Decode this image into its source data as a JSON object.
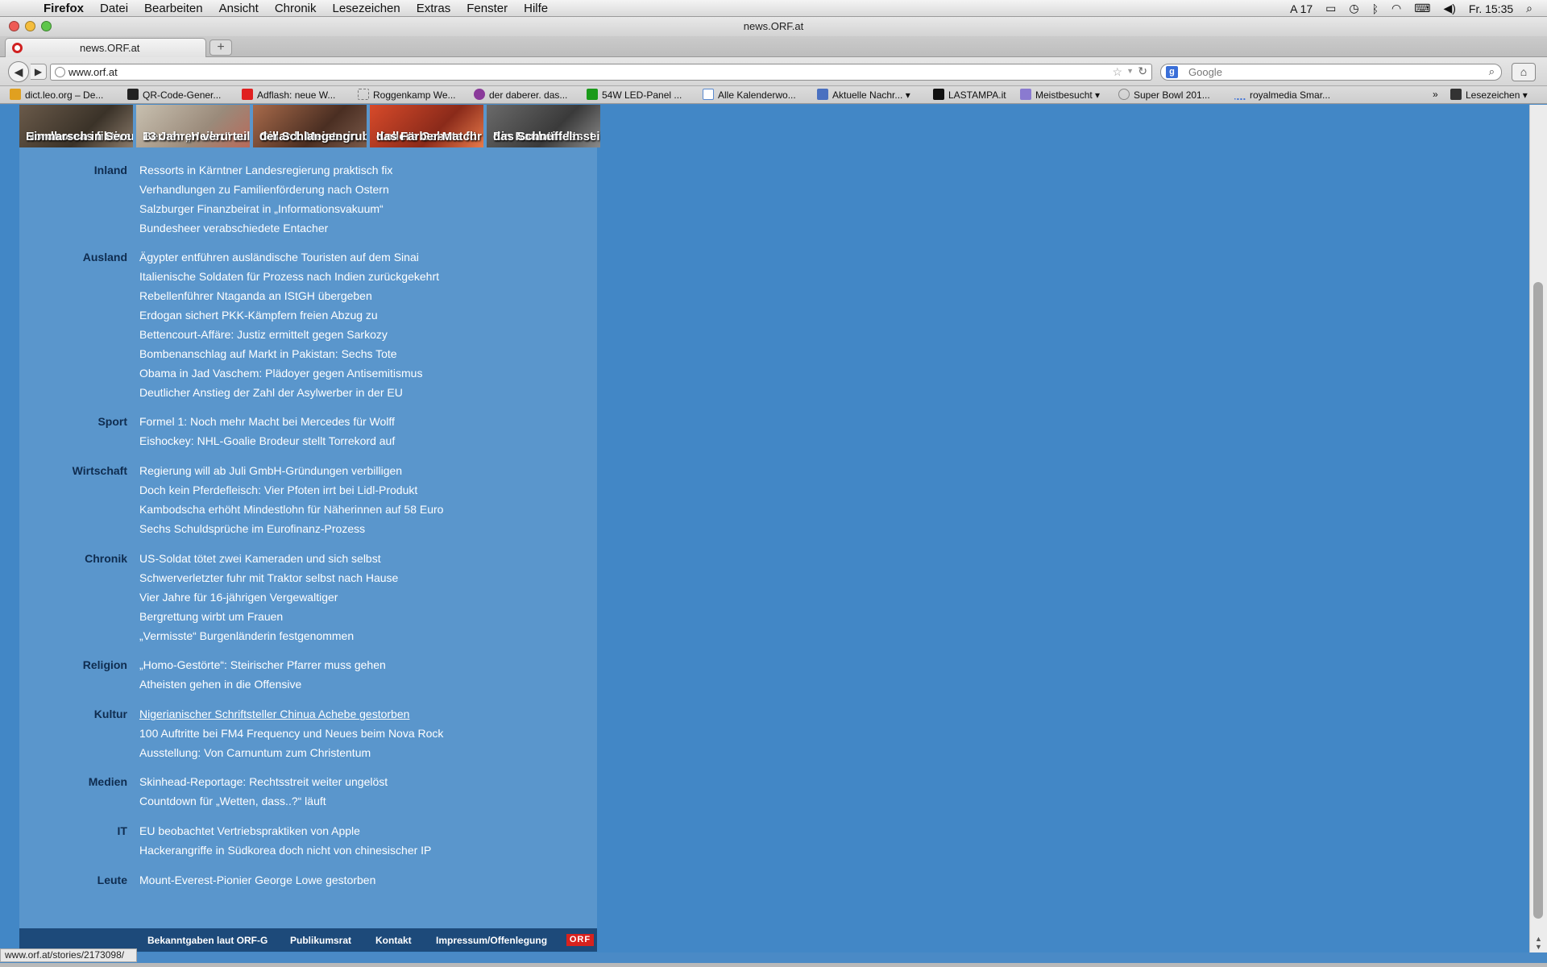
{
  "menubar": {
    "app": "Firefox",
    "items": [
      "Datei",
      "Bearbeiten",
      "Ansicht",
      "Chronik",
      "Lesezeichen",
      "Extras",
      "Fenster",
      "Hilfe"
    ],
    "adobe_count": "17",
    "clock": "Fr. 15:35"
  },
  "window": {
    "title": "news.ORF.at"
  },
  "tab": {
    "title": "news.ORF.at",
    "new_tab": "+"
  },
  "navbar": {
    "url": "www.orf.at",
    "search_placeholder": "Google"
  },
  "bookmarks": {
    "items": [
      "dict.leo.org – De...",
      "QR-Code-Gener...",
      "Adflash: neue W...",
      "Roggenkamp We...",
      "der daberer. das...",
      "54W LED-Panel ...",
      "Alle Kalenderwo...",
      "Aktuelle Nachr...",
      "LASTAMPA.it",
      "Meistbesucht",
      "Super Bowl 201...",
      "royalmedia Smar..."
    ],
    "overflow": "»",
    "lesezeichen": "Lesezeichen"
  },
  "teasers": [
    {
      "line1": "Nordkoreas fiktiver",
      "line2": "Einmarsch in Seoul"
    },
    {
      "line1": "Berner „Heiler“ zu",
      "line2": "13 Jahren verurteilt"
    },
    {
      "line1": "Gillard: Meisterin",
      "line2": "der Schlangengrube"
    },
    {
      "line1": "Kollers Gebote für",
      "line2": "das Färber-Match"
    },
    {
      "line1": "Ein Raubein lässt",
      "line2": "das Schnüffeln sein"
    }
  ],
  "sections": [
    {
      "label": "Inland",
      "items": [
        "Ressorts in Kärntner Landesregierung praktisch fix",
        "Verhandlungen zu Familienförderung nach Ostern",
        "Salzburger Finanzbeirat in „Informationsvakuum“",
        "Bundesheer verabschiedete Entacher"
      ]
    },
    {
      "label": "Ausland",
      "items": [
        "Ägypter entführen ausländische Touristen auf dem Sinai",
        "Italienische Soldaten für Prozess nach Indien zurückgekehrt",
        "Rebellenführer Ntaganda an IStGH übergeben",
        "Erdogan sichert PKK-Kämpfern freien Abzug zu",
        "Bettencourt-Affäre: Justiz ermittelt gegen Sarkozy",
        "Bombenanschlag auf Markt in Pakistan: Sechs Tote",
        "Obama in Jad Vaschem: Plädoyer gegen Antisemitismus",
        "Deutlicher Anstieg der Zahl der Asylwerber in der EU"
      ]
    },
    {
      "label": "Sport",
      "items": [
        "Formel 1: Noch mehr Macht bei Mercedes für Wolff",
        "Eishockey: NHL-Goalie Brodeur stellt Torrekord auf"
      ]
    },
    {
      "label": "Wirtschaft",
      "items": [
        "Regierung will ab Juli GmbH-Gründungen verbilligen",
        "Doch kein Pferdefleisch: Vier Pfoten irrt bei Lidl-Produkt",
        "Kambodscha erhöht Mindestlohn für Näherinnen auf 58 Euro",
        "Sechs Schuldsprüche im Eurofinanz-Prozess"
      ]
    },
    {
      "label": "Chronik",
      "items": [
        "US-Soldat tötet zwei Kameraden und sich selbst",
        "Schwerverletzter fuhr mit Traktor selbst nach Hause",
        "Vier Jahre für 16-jährigen Vergewaltiger",
        "Bergrettung wirbt um Frauen",
        "„Vermisste“ Burgenländerin festgenommen"
      ]
    },
    {
      "label": "Religion",
      "items": [
        "„Homo-Gestörte“: Steirischer Pfarrer muss gehen",
        "Atheisten gehen in die Offensive"
      ]
    },
    {
      "label": "Kultur",
      "items": [
        "Nigerianischer Schriftsteller Chinua Achebe gestorben",
        "100 Auftritte bei FM4 Frequency und Neues beim Nova Rock",
        "Ausstellung: Von Carnuntum zum Christentum"
      ]
    },
    {
      "label": "Medien",
      "items": [
        "Skinhead-Reportage: Rechtsstreit weiter ungelöst",
        "Countdown für „Wetten, dass..?“ läuft"
      ]
    },
    {
      "label": "IT",
      "items": [
        "EU beobachtet Vertriebspraktiken von Apple",
        "Hackerangriffe in Südkorea doch nicht von chinesischer IP"
      ]
    },
    {
      "label": "Leute",
      "items": [
        "Mount-Everest-Pionier George Lowe gestorben"
      ]
    }
  ],
  "footer": {
    "links": [
      "Bekanntgaben laut ORF-G",
      "Publikumsrat",
      "Kontakt",
      "Impressum/Offenlegung"
    ],
    "logo": "ORF"
  },
  "status": {
    "url": "www.orf.at/stories/2173098/"
  },
  "colors": {
    "page_bg": "#4287c6",
    "column_bg": "#5a96cc",
    "footer_bg": "#1d4a7a",
    "section_label": "#0f2c4f",
    "orf_red": "#d8221e"
  }
}
